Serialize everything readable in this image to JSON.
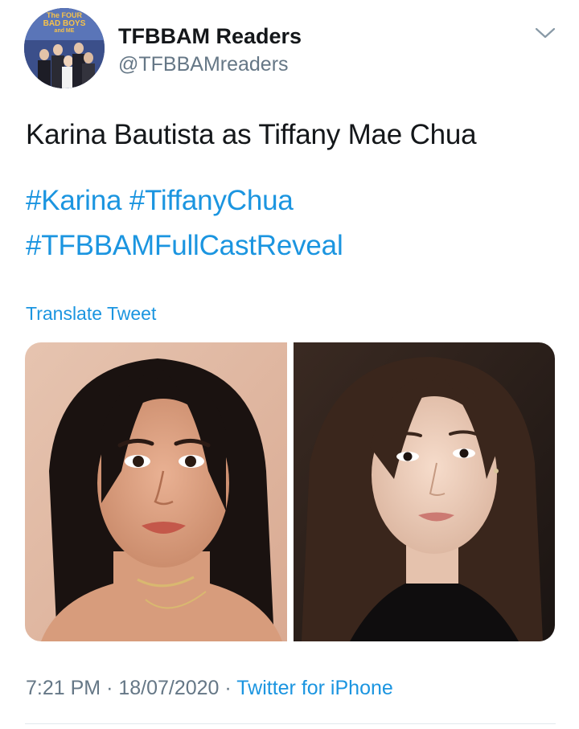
{
  "account": {
    "display_name": "TFBBAM Readers",
    "handle": "@TFBBAMreaders",
    "avatar_logo": {
      "line1": "The FOUR",
      "line2": "BAD BOYS",
      "line3": "and ME"
    }
  },
  "tweet": {
    "text": "Karina Bautista as Tiffany Mae Chua",
    "hashtags": [
      "#Karina",
      "#TiffanyChua",
      "#TFBBAMFullCastReveal"
    ],
    "translate_label": "Translate Tweet",
    "time": "7:21 PM",
    "separator": "·",
    "date": "18/07/2020",
    "source": "Twitter for iPhone"
  },
  "media": {
    "photos": [
      {
        "subject": "photo-karina"
      },
      {
        "subject": "photo-tiffany"
      }
    ]
  },
  "icons": {
    "menu": "chevron-down-icon"
  },
  "colors": {
    "text": "#14171a",
    "secondary": "#657786",
    "link": "#1b95e0",
    "divider": "#e1e8ed"
  }
}
